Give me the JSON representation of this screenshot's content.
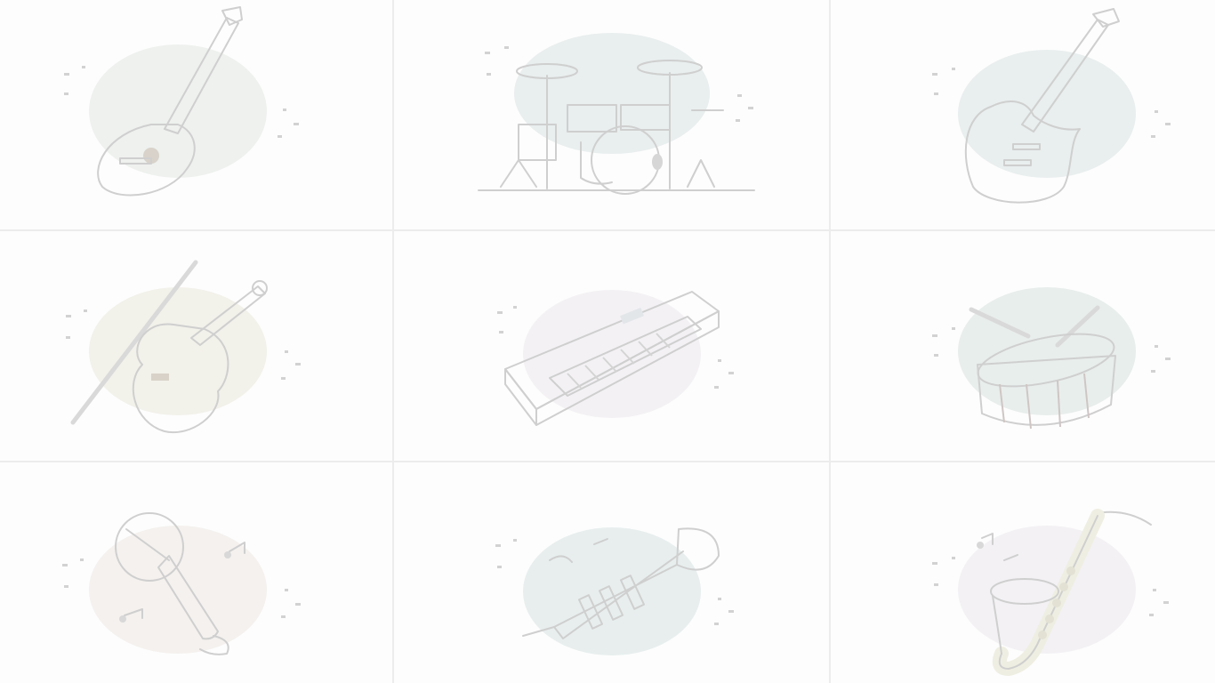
{
  "tiles": [
    {
      "icon": "acoustic-guitar-icon",
      "bg": "#eef1ee"
    },
    {
      "icon": "drum-kit-icon",
      "bg": "#e9eeee"
    },
    {
      "icon": "electric-guitar-icon",
      "bg": "#e9eeee"
    },
    {
      "icon": "violin-icon",
      "bg": "#f2f1ea"
    },
    {
      "icon": "keyboard-icon",
      "bg": "#f3f1f4"
    },
    {
      "icon": "snare-drum-icon",
      "bg": "#e8eeec"
    },
    {
      "icon": "microphone-icon",
      "bg": "#f4f1ee"
    },
    {
      "icon": "trumpet-icon",
      "bg": "#e8eeee"
    },
    {
      "icon": "saxophone-icon",
      "bg": "#f3f1f4"
    }
  ],
  "colors": {
    "background": "#fdfdfd",
    "divider": "#ececec",
    "ink": "#cfcfcf",
    "wood": "#e6ded5",
    "red": "#e4d8d6",
    "brass": "#efeee2"
  }
}
